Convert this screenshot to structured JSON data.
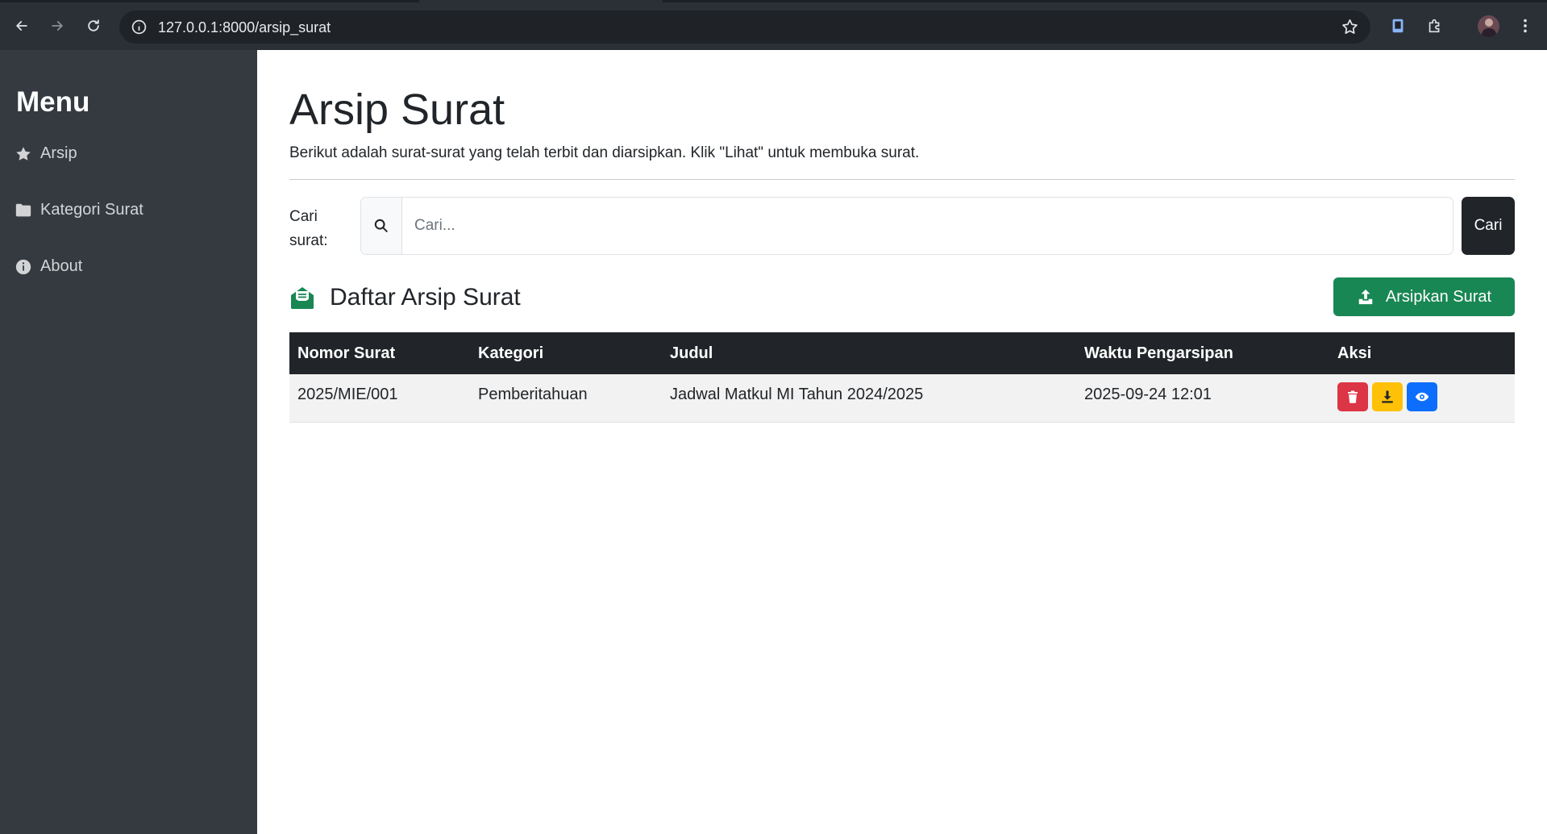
{
  "browser": {
    "url": "127.0.0.1:8000/arsip_surat"
  },
  "sidebar": {
    "title": "Menu",
    "items": [
      {
        "label": "Arsip",
        "icon": "star-icon"
      },
      {
        "label": "Kategori Surat",
        "icon": "folder-icon"
      },
      {
        "label": "About",
        "icon": "info-icon"
      }
    ]
  },
  "main": {
    "title": "Arsip Surat",
    "subtitle": "Berikut adalah surat-surat yang telah terbit dan diarsipkan. Klik \"Lihat\" untuk membuka surat.",
    "search": {
      "label": "Cari surat:",
      "placeholder": "Cari...",
      "value": "",
      "button_label": "Cari"
    },
    "section_title": "Daftar Arsip Surat",
    "upload_button_label": "Arsipkan Surat",
    "table": {
      "headers": [
        "Nomor Surat",
        "Kategori",
        "Judul",
        "Waktu Pengarsipan",
        "Aksi"
      ],
      "rows": [
        {
          "nomor": "2025/MIE/001",
          "kategori": "Pemberitahuan",
          "judul": "Jadwal Matkul MI Tahun 2024/2025",
          "waktu": "2025-09-24 12:01"
        }
      ]
    }
  },
  "colors": {
    "sidebar_bg": "#343a40",
    "accent_green": "#198754",
    "danger": "#dc3545",
    "warning": "#ffc107",
    "primary": "#0d6efd",
    "dark": "#212529"
  }
}
